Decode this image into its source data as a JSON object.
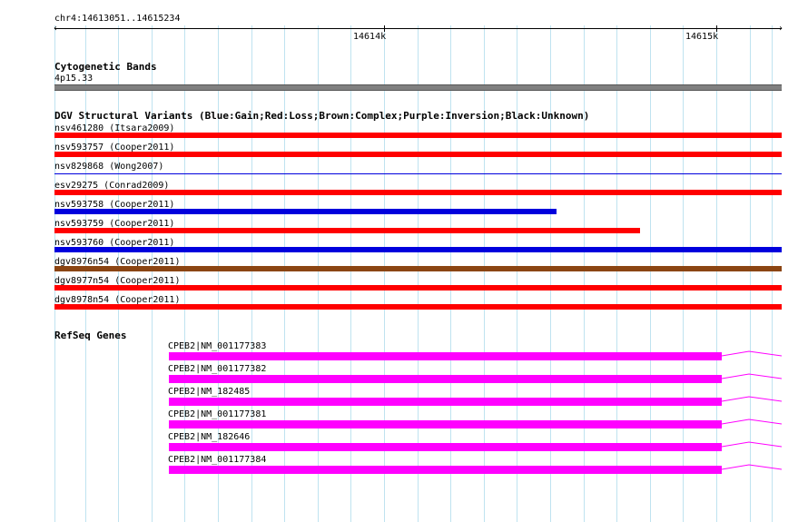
{
  "ruler": {
    "location": "chr4:14613051..14615234",
    "major_ticks": [
      {
        "label": "14614k"
      },
      {
        "label": "14615k"
      }
    ]
  },
  "cytoband": {
    "title": "Cytogenetic Bands",
    "band_label": "4p15.33",
    "color": "#808080"
  },
  "dgv": {
    "title": "DGV Structural Variants (Blue:Gain;Red:Loss;Brown:Complex;Purple:Inversion;Black:Unknown)",
    "colors": {
      "gain": "#0000dd",
      "loss": "#ff0000",
      "complex": "#8b4513",
      "inversion": "#800080",
      "unknown": "#000000"
    },
    "variants": [
      {
        "label": "nsv461280 (Itsara2009)",
        "type": "loss"
      },
      {
        "label": "nsv593757 (Cooper2011)",
        "type": "loss"
      },
      {
        "label": "nsv829868 (Wong2007)",
        "type": "gain"
      },
      {
        "label": "esv29275 (Conrad2009)",
        "type": "loss"
      },
      {
        "label": "nsv593758 (Cooper2011)",
        "type": "gain"
      },
      {
        "label": "nsv593759 (Cooper2011)",
        "type": "loss"
      },
      {
        "label": "nsv593760 (Cooper2011)",
        "type": "gain"
      },
      {
        "label": "dgv8976n54 (Cooper2011)",
        "type": "complex"
      },
      {
        "label": "dgv8977n54 (Cooper2011)",
        "type": "loss"
      },
      {
        "label": "dgv8978n54 (Cooper2011)",
        "type": "loss"
      }
    ]
  },
  "refseq": {
    "title": "RefSeq Genes",
    "color": "#ff00ff",
    "genes": [
      {
        "label": "CPEB2|NM_001177383"
      },
      {
        "label": "CPEB2|NM_001177382"
      },
      {
        "label": "CPEB2|NM_182485"
      },
      {
        "label": "CPEB2|NM_001177381"
      },
      {
        "label": "CPEB2|NM_182646"
      },
      {
        "label": "CPEB2|NM_001177384"
      }
    ]
  }
}
